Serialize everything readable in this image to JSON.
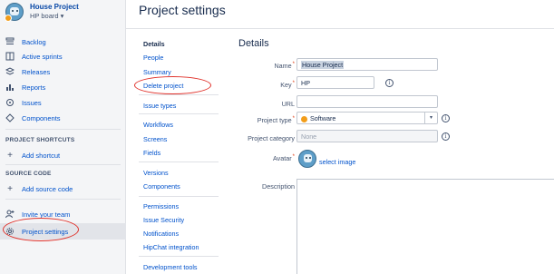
{
  "sidebar": {
    "project_name": "House Project",
    "board_name": "HP board",
    "board_caret": "▾",
    "nav": [
      {
        "label": "Backlog",
        "icon": "backlog-icon"
      },
      {
        "label": "Active sprints",
        "icon": "active-sprints-icon"
      },
      {
        "label": "Releases",
        "icon": "releases-icon"
      },
      {
        "label": "Reports",
        "icon": "reports-icon"
      },
      {
        "label": "Issues",
        "icon": "issues-icon"
      },
      {
        "label": "Components",
        "icon": "components-icon"
      }
    ],
    "shortcuts_title": "PROJECT SHORTCUTS",
    "add_shortcut": "Add shortcut",
    "source_title": "SOURCE CODE",
    "add_source": "Add source code",
    "invite": "Invite your team",
    "project_settings": "Project settings"
  },
  "header": {
    "title": "Project settings"
  },
  "settings_nav": {
    "details": "Details",
    "people": "People",
    "summary": "Summary",
    "delete": "Delete project",
    "issue_types": "Issue types",
    "workflows": "Workflows",
    "screens": "Screens",
    "fields": "Fields",
    "versions": "Versions",
    "components": "Components",
    "permissions": "Permissions",
    "issue_security": "Issue Security",
    "notifications": "Notifications",
    "hipchat": "HipChat integration",
    "dev_tools": "Development tools"
  },
  "details": {
    "title": "Details",
    "name_label": "Name",
    "name_value": "House Project",
    "key_label": "Key",
    "key_value": "HP",
    "url_label": "URL",
    "url_value": "",
    "type_label": "Project type",
    "type_value": "Software",
    "category_label": "Project category",
    "category_value": "None",
    "avatar_label": "Avatar",
    "select_image": "select image",
    "description_label": "Description",
    "required_mark": "*",
    "info_glyph": "i"
  },
  "colors": {
    "link": "#0052cc",
    "annotation_red": "#e0312a",
    "software_orange": "#f29d1a"
  }
}
